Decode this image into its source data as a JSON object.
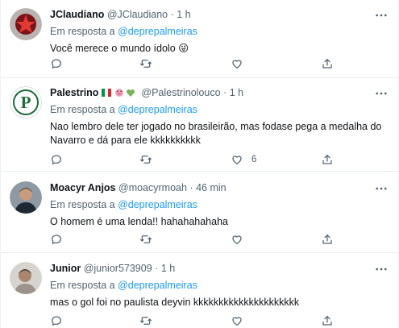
{
  "common": {
    "reply_prefix": "Em resposta a",
    "reply_handle": "@deprepalmeiras",
    "separator": "·"
  },
  "tweets": [
    {
      "name": "JClaudiano",
      "handle": "@JClaudiano",
      "time": "1 h",
      "text": "Você merece o mundo ídolo 😜",
      "likes": ""
    },
    {
      "name": "Palestrino",
      "badges": "🇮🇹🐷💚",
      "handle": "@Palestrinolouco",
      "time": "1 h",
      "text": "Nao lembro dele ter jogado no brasileirão, mas fodase pega a medalha do\nNavarro e dá para ele kkkkkkkkkk",
      "likes": "6"
    },
    {
      "name": "Moacyr Anjos",
      "handle": "@moacyrmoah",
      "time": "46 min",
      "text": "O homem é uma lenda!! hahahahahaha",
      "likes": ""
    },
    {
      "name": "Junior",
      "handle": "@junior573909",
      "time": "1 h",
      "text": "mas o gol foi no paulista deyvin kkkkkkkkkkkkkkkkkkkkk",
      "likes": ""
    }
  ],
  "icons": {
    "reply": "reply-icon",
    "retweet": "retweet-icon",
    "like": "heart-icon",
    "share": "share-icon",
    "more": "more-icon"
  },
  "colors": {
    "link": "#1d9bf0",
    "secondary": "#536471",
    "text": "#0f1419",
    "divider": "#e6ecf0"
  }
}
